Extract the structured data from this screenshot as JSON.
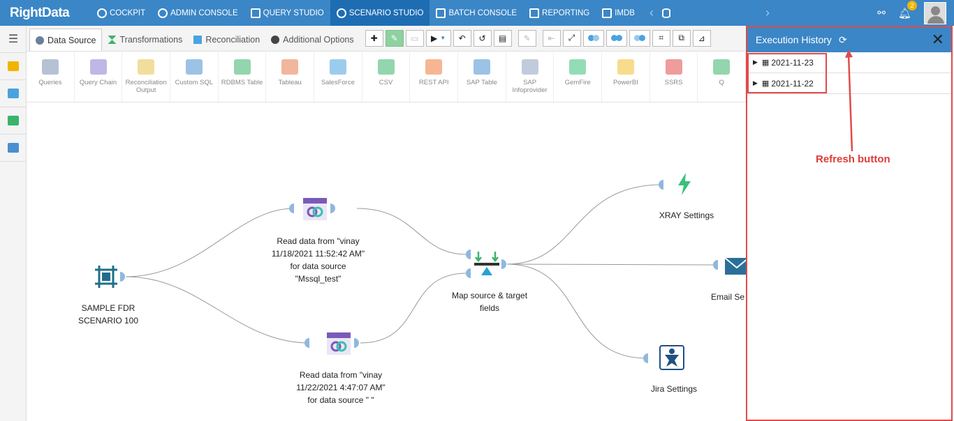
{
  "app": {
    "logo": "RightData"
  },
  "nav": {
    "items": [
      {
        "label": "COCKPIT",
        "icon": "dashboard-icon"
      },
      {
        "label": "ADMIN CONSOLE",
        "icon": "gear-icon"
      },
      {
        "label": "QUERY STUDIO",
        "icon": "database-icon"
      },
      {
        "label": "SCENARIO STUDIO",
        "icon": "flow-icon",
        "active": true
      },
      {
        "label": "BATCH CONSOLE",
        "icon": "book-icon"
      },
      {
        "label": "REPORTING",
        "icon": "chart-icon"
      },
      {
        "label": "IMDB",
        "icon": "imdb-icon"
      }
    ],
    "notification_count": "2"
  },
  "tabs": [
    {
      "label": "Data Source",
      "active": true
    },
    {
      "label": "Transformations"
    },
    {
      "label": "Reconciliation"
    },
    {
      "label": "Additional Options"
    }
  ],
  "palette": [
    {
      "label": "Queries",
      "color": "#7a8fb0"
    },
    {
      "label": "Query Chain",
      "color": "#8a7bd0"
    },
    {
      "label": "Reconciliation Output",
      "color": "#e8c24a"
    },
    {
      "label": "Custom SQL",
      "color": "#4a8fd0"
    },
    {
      "label": "RDBMS Table",
      "color": "#3bb36a"
    },
    {
      "label": "Tableau",
      "color": "#e87a4a"
    },
    {
      "label": "SalesForce",
      "color": "#4aa3df"
    },
    {
      "label": "CSV",
      "color": "#3bb36a"
    },
    {
      "label": "REST API",
      "color": "#f07a3a"
    },
    {
      "label": "SAP Table",
      "color": "#4a8fd0"
    },
    {
      "label": "SAP Infoprovider",
      "color": "#8fa0c0"
    },
    {
      "label": "GemFire",
      "color": "#3bc07a"
    },
    {
      "label": "PowerBI",
      "color": "#f0c030"
    },
    {
      "label": "SSRS",
      "color": "#e04a4a"
    },
    {
      "label": "Q",
      "color": "#3bb36a"
    }
  ],
  "canvas": {
    "nodes": {
      "scenario": "SAMPLE FDR SCENARIO 100",
      "read1_l1": "Read data from \"vinay",
      "read1_l2": "11/18/2021 11:52:42 AM\"",
      "read1_l3": "for data source",
      "read1_l4": "\"Mssql_test\"",
      "read2_l1": "Read data from \"vinay",
      "read2_l2": "11/22/2021 4:47:07 AM\"",
      "read2_l3": "for data source \" \"",
      "map_l1": "Map source & target",
      "map_l2": "fields",
      "xray": "XRAY Settings",
      "email": "Email Se",
      "jira": "Jira Settings"
    }
  },
  "history": {
    "title": "Execution History",
    "dates": [
      "2021-11-23",
      "2021-11-22"
    ],
    "annotation": "Refresh button"
  },
  "colors": {
    "accent": "#3b86c6",
    "highlight": "#e24a4a"
  }
}
